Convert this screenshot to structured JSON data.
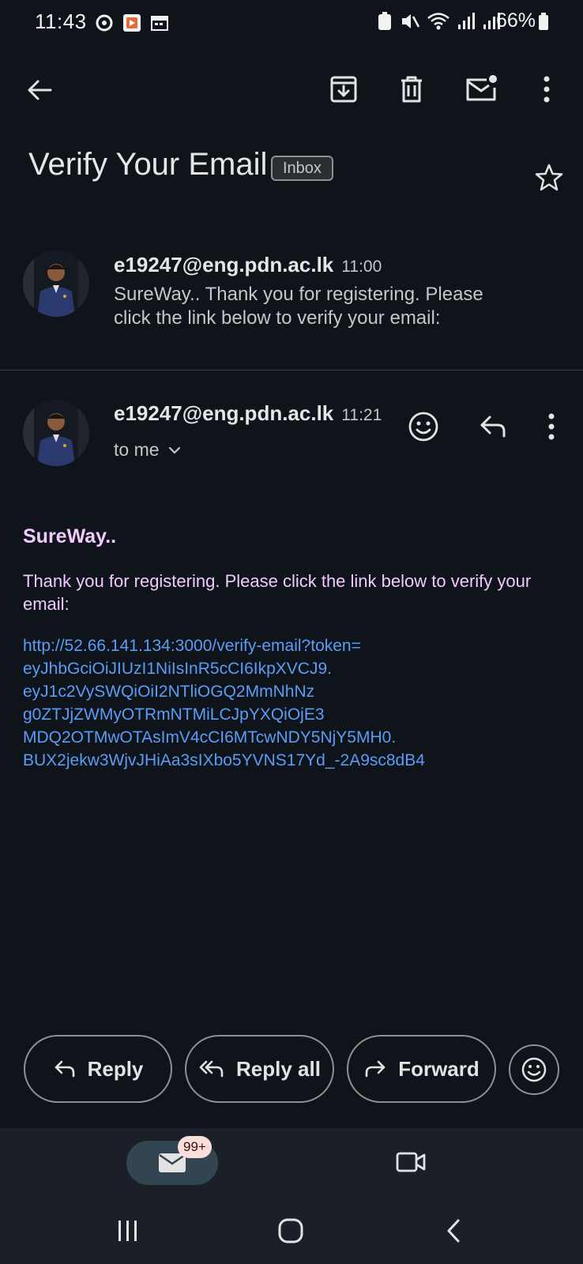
{
  "status_bar": {
    "time": "11:43",
    "battery": "66%"
  },
  "toolbar": {
    "back_icon": "arrow-left-icon",
    "archive_icon": "archive-icon",
    "delete_icon": "trash-icon",
    "mark_unread_icon": "mail-unread-icon",
    "more_icon": "more-vert-icon"
  },
  "subject": {
    "title": "Verify Your Email",
    "label": "Inbox"
  },
  "thread": [
    {
      "sender": "e19247@eng.pdn.ac.lk",
      "time": "11:00",
      "snippet": "SureWay.. Thank you for registering. Please click the link below to verify your email:"
    },
    {
      "sender": "e19247@eng.pdn.ac.lk",
      "time": "11:21",
      "recipient": "to me"
    }
  ],
  "message": {
    "heading": "SureWay..",
    "text": "Thank you for registering. Please click the link below to verify your email:",
    "link_lines": [
      "http://52.66.141.134:3000/verify-email?token=",
      "eyJhbGciOiJIUzI1NiIsInR5cCI6IkpXVCJ9.",
      "eyJ1c2VySWQiOiI2NTliOGQ2MmNhNz",
      "g0ZTJjZWMyOTRmNTMiLCJpYXQiOjE3",
      "MDQ2OTMwOTAsImV4cCI6MTcwNDY5NjY5MH0.",
      "BUX2jekw3WjvJHiAa3sIXbo5YVNS17Yd_-2A9sc8dB4"
    ]
  },
  "actions": {
    "reply": "Reply",
    "reply_all": "Reply all",
    "forward": "Forward"
  },
  "bottom_nav": {
    "mail_badge": "99+"
  },
  "colors": {
    "background": "#0f141b",
    "accent_pink": "#f2c9ff",
    "link_blue": "#5b9cf5"
  }
}
